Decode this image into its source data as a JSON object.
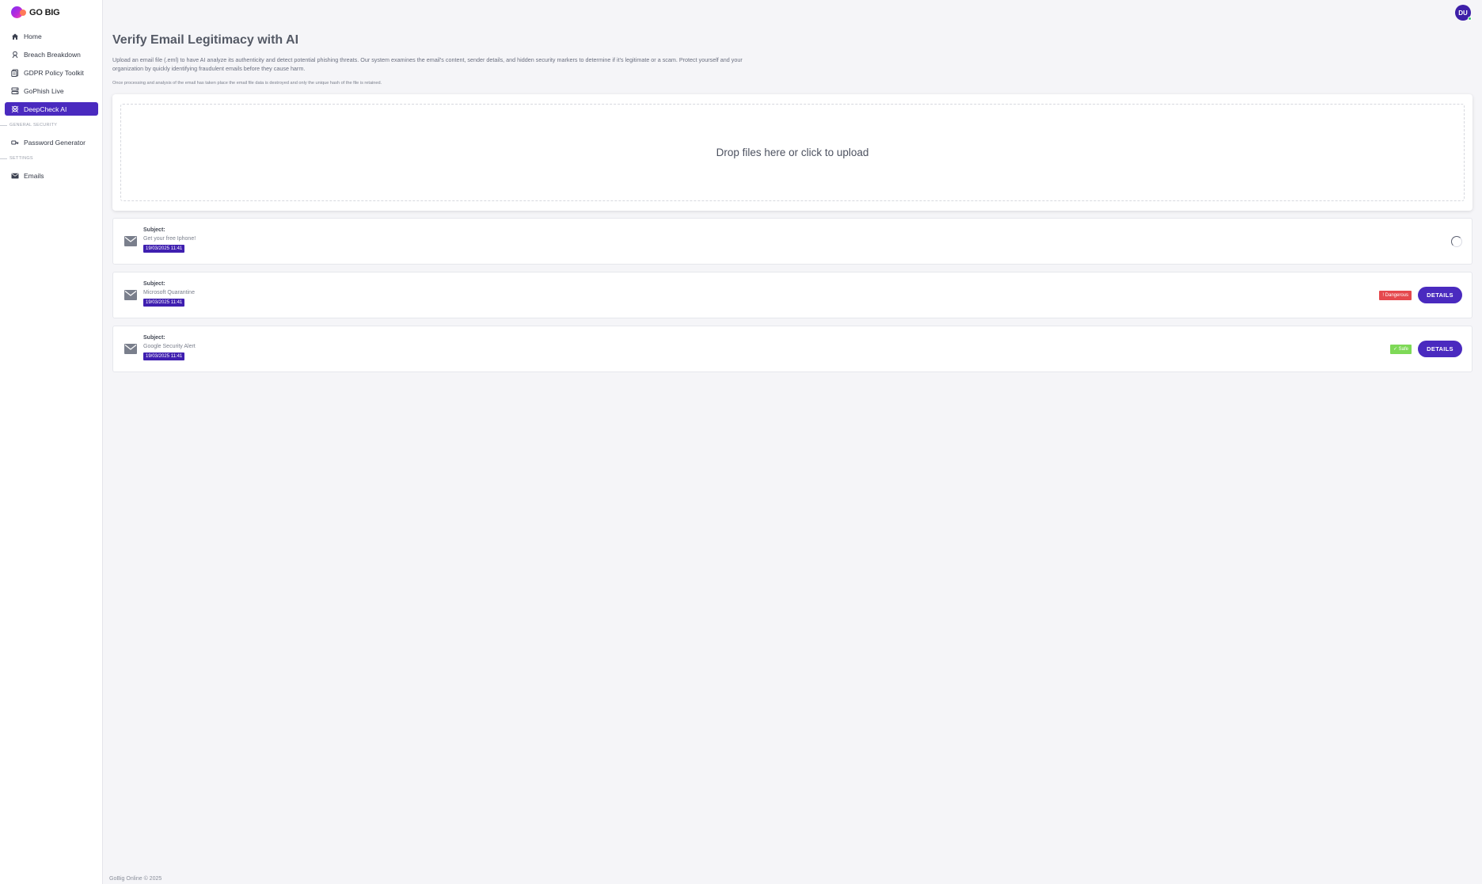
{
  "brand": {
    "name": "GO BIG"
  },
  "sidebar": {
    "items": [
      {
        "label": "Home",
        "icon": "home-icon"
      },
      {
        "label": "Breach Breakdown",
        "icon": "breach-icon"
      },
      {
        "label": "GDPR Policy Toolkit",
        "icon": "document-icon"
      },
      {
        "label": "GoPhish Live",
        "icon": "server-icon"
      },
      {
        "label": "DeepCheck AI",
        "icon": "skull-icon",
        "active": true
      }
    ],
    "sections": [
      {
        "title": "GENERAL SECURITY",
        "items": [
          {
            "label": "Password Generator",
            "icon": "key-icon"
          }
        ]
      },
      {
        "title": "SETTINGS",
        "items": [
          {
            "label": "Emails",
            "icon": "mail-icon"
          }
        ]
      }
    ]
  },
  "user": {
    "initials": "DU"
  },
  "main": {
    "title": "Verify Email Legitimacy with AI",
    "description": "Upload an email file (.eml) to have AI analyze its authenticity and detect potential phishing threats. Our system examines the email's content, sender details, and hidden security markers to determine if it's legitimate or a scam. Protect yourself and your organization by quickly identifying fraudulent emails before they cause harm.",
    "note": "Once processing and analysis of the email has taken place the email file data is destroyed and only the unique hash of the file is retained.",
    "dropzone_text": "Drop files here or click to upload"
  },
  "emails": [
    {
      "subject_label": "Subject:",
      "subject": "Get your free Iphone!",
      "date": "19/03/2025 11:41",
      "status": "processing"
    },
    {
      "subject_label": "Subject:",
      "subject": "Microsoft Quarantine",
      "date": "19/03/2025 11:41",
      "status": "! Dangerous",
      "details_label": "DETAILS"
    },
    {
      "subject_label": "Subject:",
      "subject": "Google Security Alert",
      "date": "19/03/2025 11:41",
      "status": "✓ Safe",
      "details_label": "DETAILS"
    }
  ],
  "colors": {
    "accent": "#4a2abf",
    "danger": "#e5484d",
    "safe": "#7ed957"
  },
  "footer": {
    "text": "GoBig Online © 2025"
  }
}
